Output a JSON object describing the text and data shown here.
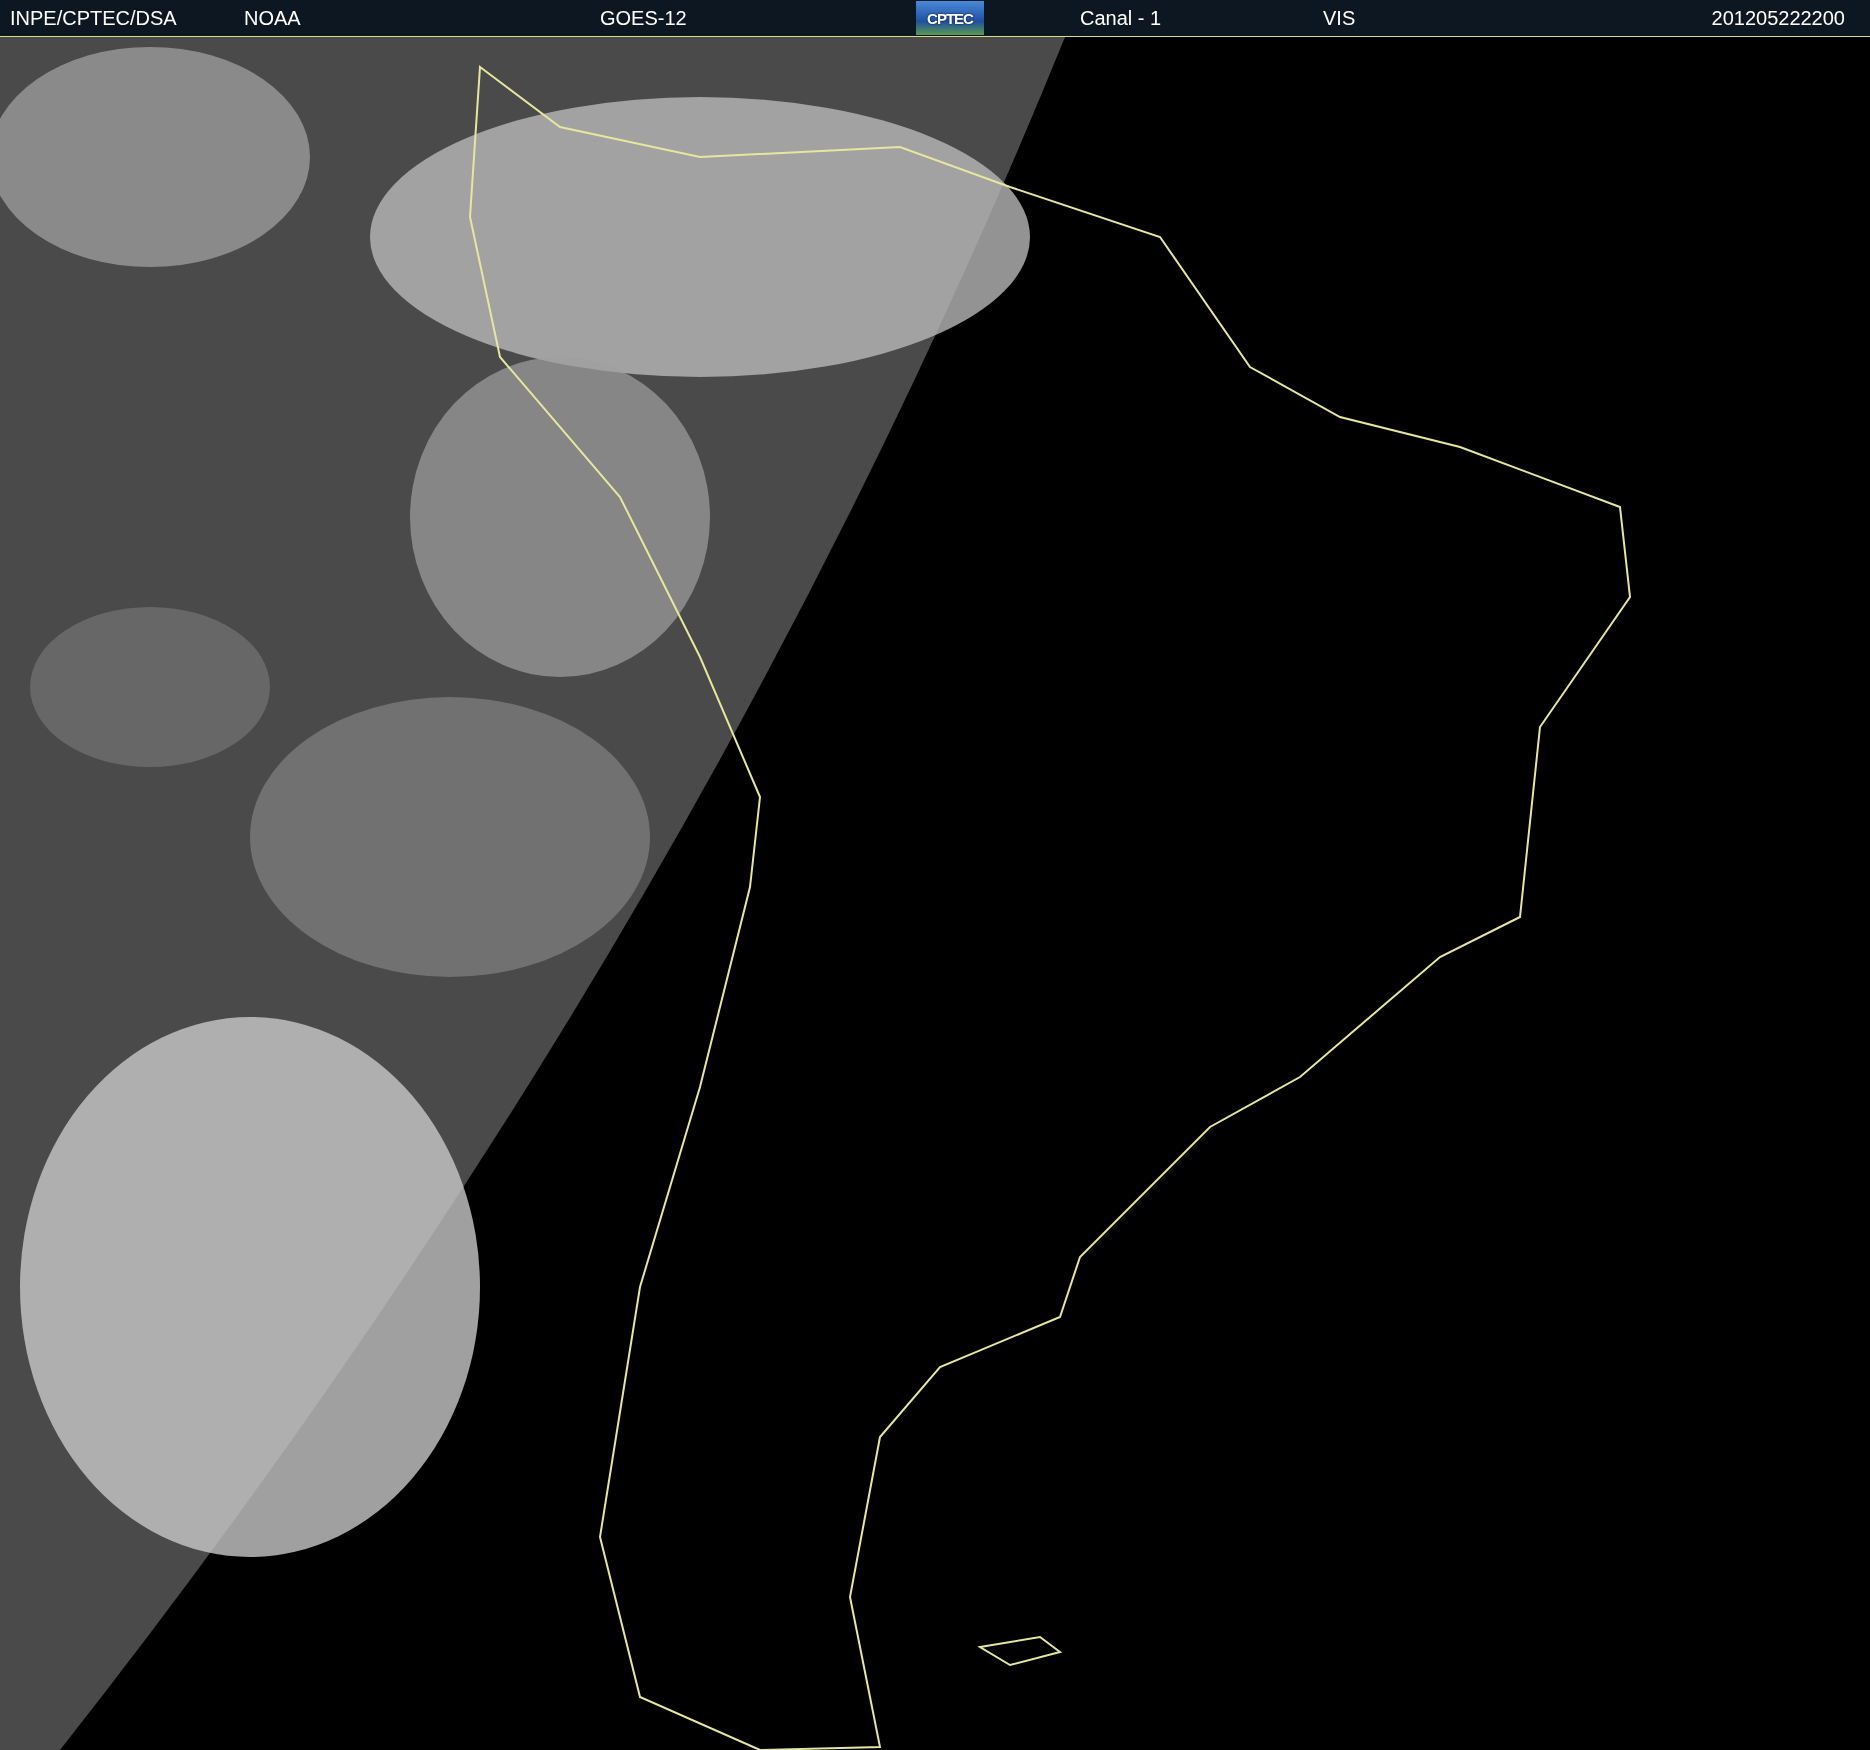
{
  "header": {
    "items": [
      {
        "kind": "text",
        "text": "INPE/CPTEC/DSA"
      },
      {
        "kind": "text",
        "text": "NOAA"
      },
      {
        "kind": "text",
        "text": "GOES-12"
      },
      {
        "kind": "logo",
        "text": "CPTEC"
      },
      {
        "kind": "text",
        "text": "Canal - 1"
      },
      {
        "kind": "text",
        "text": "VIS"
      },
      {
        "kind": "text",
        "text": "201205222200"
      }
    ]
  }
}
